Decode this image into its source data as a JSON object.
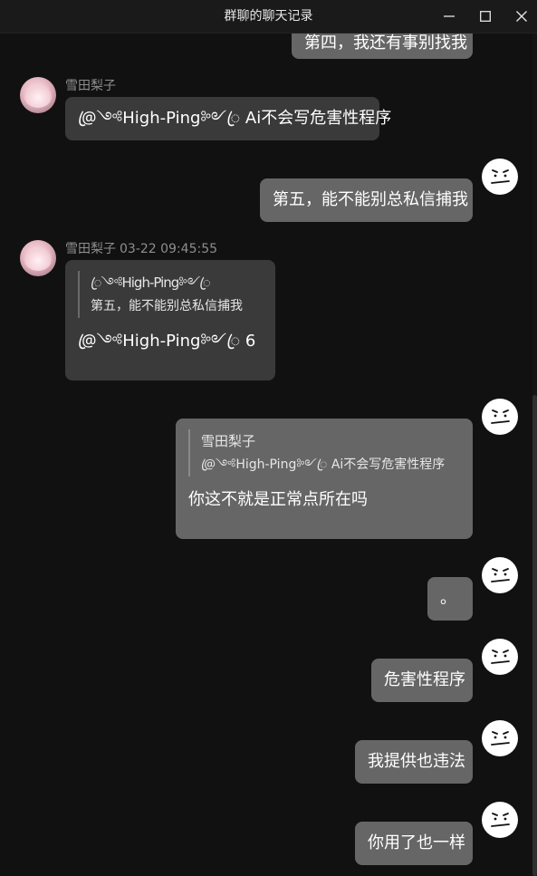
{
  "window": {
    "title": "群聊的聊天记录"
  },
  "messages": {
    "m0": {
      "text": "第四，我还有事别找我"
    },
    "m1": {
      "sender": "雪田梨子",
      "text": "@ꦿ༺High-Ping༻ꦿ Ai不会写危害性程序"
    },
    "m2": {
      "text": "第五，能不能别总私信捕我"
    },
    "m3": {
      "sender": "雪田梨子",
      "time": "03-22 09:45:55",
      "quote_name": "ꦿ༺High-Ping༻ꦿ",
      "quote_text": "第五，能不能别总私信捕我",
      "text": "@ꦿ༺High-Ping༻ꦿ 6"
    },
    "m4": {
      "quote_name": "雪田梨子",
      "quote_text": "@ꦿ༺High-Ping༻ꦿ Ai不会写危害性程序",
      "text": "你这不就是正常点所在吗"
    },
    "m5": {
      "text": "。"
    },
    "m6": {
      "text": "危害性程序"
    },
    "m7": {
      "text": "我提供也违法"
    },
    "m8": {
      "text": "你用了也一样"
    }
  },
  "icons": {
    "minimize": "minimize-icon",
    "maximize": "maximize-icon",
    "close": "close-icon",
    "self_avatar": "neutral-face-icon"
  },
  "colors": {
    "background": "#111111",
    "bubble_other": "#3a3a3a",
    "bubble_self": "#666666",
    "sender_text": "#8e8e8e"
  }
}
